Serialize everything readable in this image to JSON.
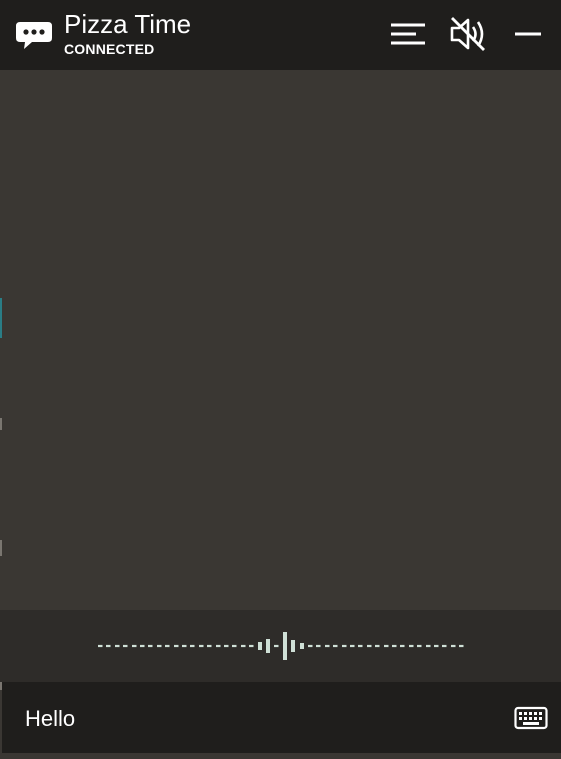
{
  "header": {
    "title": "Pizza Time",
    "status": "CONNECTED",
    "icons": {
      "chat": "chat-bubble-icon",
      "menu": "menu-icon",
      "mute": "speaker-muted-icon",
      "minimize": "minimize-icon"
    }
  },
  "voice": {
    "indicator": "waveform-icon"
  },
  "input": {
    "message": "Hello",
    "keyboard_icon": "keyboard-icon"
  },
  "colors": {
    "header_bg": "#1f1e1c",
    "conversation_bg": "#3a3733",
    "voice_bar_bg": "#2e2c29",
    "wave_color": "#cfe0d6",
    "text": "#ffffff"
  }
}
